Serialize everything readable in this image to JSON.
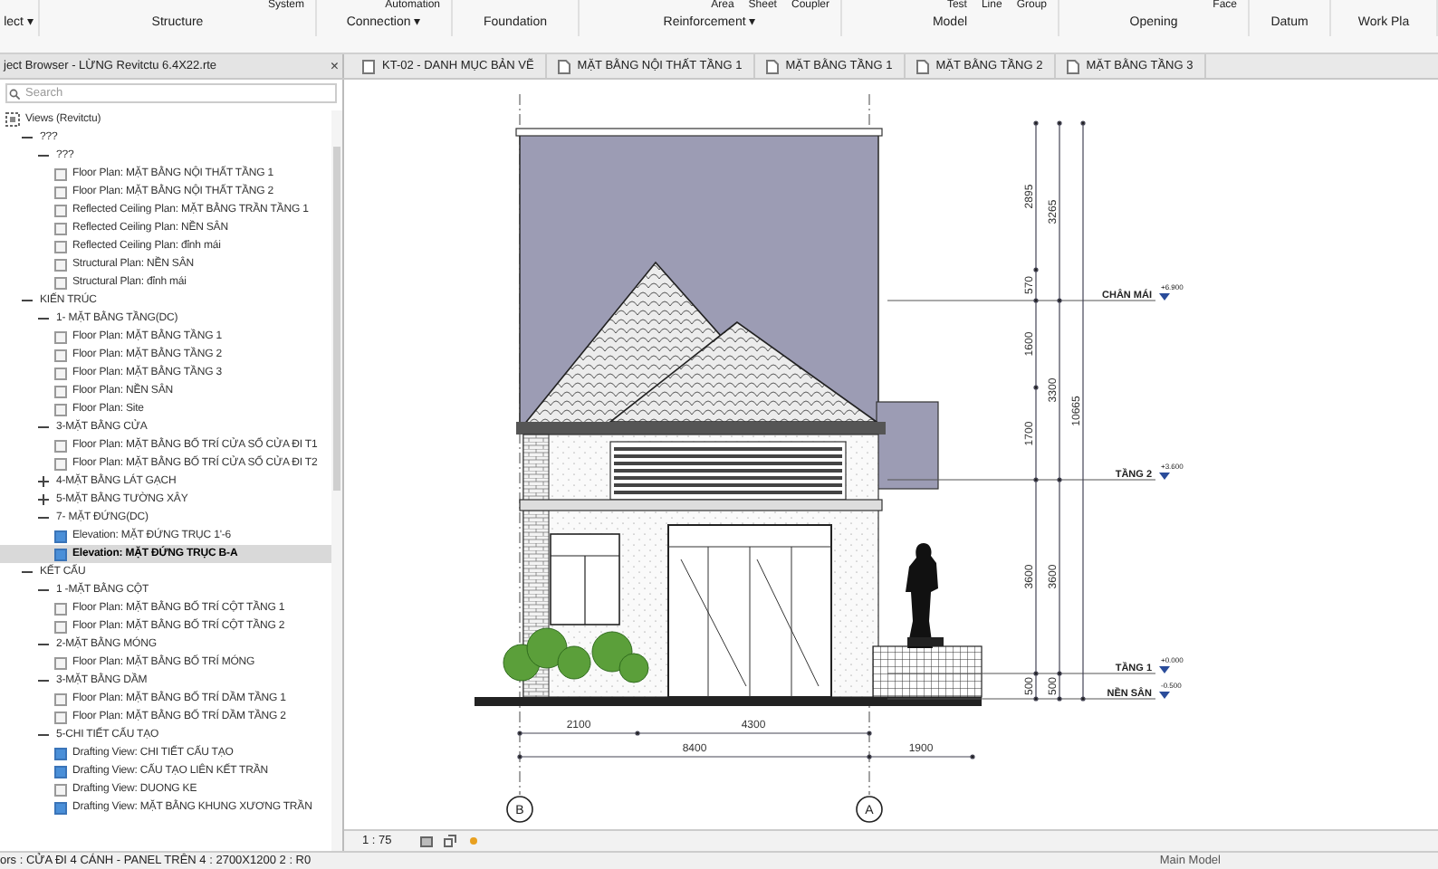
{
  "ribbon": {
    "panels": [
      {
        "label": "lect ▾"
      },
      {
        "label": "Structure",
        "items": [
          "System"
        ]
      },
      {
        "label": "Connection ▾",
        "items": [
          "Automation"
        ]
      },
      {
        "label": "Foundation"
      },
      {
        "label": "Reinforcement ▾",
        "items": [
          "Area",
          "Sheet",
          "Coupler"
        ]
      },
      {
        "label": "Model",
        "items": [
          "Test",
          "Line",
          "Group"
        ]
      },
      {
        "label": "Opening",
        "items": [
          "Face"
        ]
      },
      {
        "label": "Datum"
      },
      {
        "label": "Work Pla"
      }
    ]
  },
  "project_browser": {
    "title": "ject Browser - LỪNG Revitctu 6.4X22.rte",
    "close": "×",
    "search": {
      "placeholder": "Search"
    },
    "tree": [
      {
        "label": "Views (Revitctu)",
        "kind": "root",
        "children": [
          {
            "label": "???",
            "kind": "group",
            "expanded": true,
            "children": [
              {
                "label": "???",
                "kind": "group",
                "expanded": true,
                "children": [
                  {
                    "label": "Floor Plan: MẶT BẰNG NỘI THẤT TẦNG 1",
                    "kind": "view",
                    "on_sheet": false,
                    "selected": false
                  },
                  {
                    "label": "Floor Plan: MẶT BẰNG NỘI THẤT TẦNG 2",
                    "kind": "view",
                    "on_sheet": false,
                    "selected": false
                  },
                  {
                    "label": "Reflected Ceiling Plan: MẶT BẰNG TRẦN TẦNG 1",
                    "kind": "view",
                    "on_sheet": false,
                    "selected": false
                  },
                  {
                    "label": "Reflected Ceiling Plan: NỀN SÂN",
                    "kind": "view",
                    "on_sheet": false,
                    "selected": false
                  },
                  {
                    "label": "Reflected Ceiling Plan: đỉnh mái",
                    "kind": "view",
                    "on_sheet": false,
                    "selected": false
                  },
                  {
                    "label": "Structural Plan: NỀN SÂN",
                    "kind": "view",
                    "on_sheet": false,
                    "selected": false
                  },
                  {
                    "label": "Structural Plan: đỉnh mái",
                    "kind": "view",
                    "on_sheet": false,
                    "selected": false
                  }
                ]
              }
            ]
          },
          {
            "label": "KIẾN TRÚC",
            "kind": "group",
            "expanded": true,
            "children": [
              {
                "label": "1- MẶT BẰNG TẦNG(DC)",
                "kind": "group",
                "expanded": true,
                "children": [
                  {
                    "label": "Floor Plan: MẶT BẰNG TẦNG 1",
                    "kind": "view",
                    "on_sheet": false,
                    "selected": false
                  },
                  {
                    "label": "Floor Plan: MẶT BẰNG TẦNG 2",
                    "kind": "view",
                    "on_sheet": false,
                    "selected": false
                  },
                  {
                    "label": "Floor Plan: MẶT BẰNG TẦNG 3",
                    "kind": "view",
                    "on_sheet": false,
                    "selected": false
                  },
                  {
                    "label": "Floor Plan: NỀN SÂN",
                    "kind": "view",
                    "on_sheet": false,
                    "selected": false
                  },
                  {
                    "label": "Floor Plan: Site",
                    "kind": "view",
                    "on_sheet": false,
                    "selected": false
                  }
                ]
              },
              {
                "label": "3-MẶT BẰNG CỬA",
                "kind": "group",
                "expanded": true,
                "children": [
                  {
                    "label": "Floor Plan: MẶT BẰNG BỐ TRÍ CỬA SỔ CỬA ĐI T1",
                    "kind": "view",
                    "on_sheet": false,
                    "selected": false
                  },
                  {
                    "label": "Floor Plan: MẶT BẰNG BỐ TRÍ CỬA SỔ CỬA ĐI T2",
                    "kind": "view",
                    "on_sheet": false,
                    "selected": false
                  }
                ]
              },
              {
                "label": "4-MẶT BẰNG LÁT GẠCH",
                "kind": "group",
                "expanded": false
              },
              {
                "label": "5-MẶT BẰNG TƯỜNG XÂY",
                "kind": "group",
                "expanded": false
              },
              {
                "label": "7- MẶT ĐỨNG(DC)",
                "kind": "group",
                "expanded": true,
                "children": [
                  {
                    "label": "Elevation: MẶT ĐỨNG TRỤC 1'-6",
                    "kind": "view",
                    "on_sheet": true,
                    "selected": false
                  },
                  {
                    "label": "Elevation: MẶT ĐỨNG TRỤC B-A",
                    "kind": "view",
                    "on_sheet": true,
                    "selected": true
                  }
                ]
              }
            ]
          },
          {
            "label": "KẾT CẤU",
            "kind": "group",
            "expanded": true,
            "children": [
              {
                "label": "1 -MẶT BẰNG CỘT",
                "kind": "group",
                "expanded": true,
                "children": [
                  {
                    "label": "Floor Plan: MẶT BẰNG BỐ TRÍ CỘT TẦNG 1",
                    "kind": "view",
                    "on_sheet": false,
                    "selected": false
                  },
                  {
                    "label": "Floor Plan: MẶT BẰNG BỐ TRÍ CỘT TẦNG 2",
                    "kind": "view",
                    "on_sheet": false,
                    "selected": false
                  }
                ]
              },
              {
                "label": "2-MẶT BẰNG MÓNG",
                "kind": "group",
                "expanded": true,
                "children": [
                  {
                    "label": "Floor Plan: MẶT BẰNG BỐ TRÍ MÓNG",
                    "kind": "view",
                    "on_sheet": false,
                    "selected": false
                  }
                ]
              },
              {
                "label": "3-MẶT BẰNG DẦM",
                "kind": "group",
                "expanded": true,
                "children": [
                  {
                    "label": "Floor Plan: MẶT BẰNG BỐ TRÍ DẦM TẦNG 1",
                    "kind": "view",
                    "on_sheet": false,
                    "selected": false
                  },
                  {
                    "label": "Floor Plan: MẶT BẰNG BỐ TRÍ DẦM TẦNG 2",
                    "kind": "view",
                    "on_sheet": false,
                    "selected": false
                  }
                ]
              },
              {
                "label": "5-CHI TIẾT CẤU TẠO",
                "kind": "group",
                "expanded": true,
                "children": [
                  {
                    "label": "Drafting View: CHI TIẾT CẤU TẠO",
                    "kind": "view",
                    "on_sheet": true,
                    "selected": false
                  },
                  {
                    "label": "Drafting View: CẤU TẠO LIÊN KẾT TRẦN",
                    "kind": "view",
                    "on_sheet": true,
                    "selected": false
                  },
                  {
                    "label": "Drafting View: DUONG KE",
                    "kind": "view",
                    "on_sheet": false,
                    "selected": false
                  },
                  {
                    "label": "Drafting View: MẶT BẰNG KHUNG XƯƠNG TRẦN",
                    "kind": "view",
                    "on_sheet": true,
                    "selected": false
                  }
                ]
              }
            ]
          }
        ]
      }
    ]
  },
  "document_tabs": [
    {
      "label": "KT-02 - DANH MỤC BẢN VẼ",
      "kind": "sheet",
      "selected": false
    },
    {
      "label": "MẶT BẰNG NỘI THẤT TẦNG 1",
      "kind": "plan",
      "selected": false
    },
    {
      "label": "MẶT BẰNG TẦNG 1",
      "kind": "plan",
      "selected": false
    },
    {
      "label": "MẶT BẰNG TẦNG 2",
      "kind": "plan",
      "selected": false
    },
    {
      "label": "MẶT BẰNG TẦNG 3",
      "kind": "plan",
      "selected": false
    }
  ],
  "drawing": {
    "vertical_dimensions": [
      [
        "2895",
        "570",
        "1600",
        "1700",
        "3600",
        "500"
      ],
      [
        "3265",
        "3300",
        "3600",
        "500"
      ],
      [
        "10665"
      ]
    ],
    "levels": [
      {
        "name": "CHÂN MÁI",
        "elevation": "+6.900"
      },
      {
        "name": "TẦNG 2",
        "elevation": "+3.600"
      },
      {
        "name": "TẦNG 1",
        "elevation": "+0.000"
      },
      {
        "name": "NỀN SÂN",
        "elevation": "-0.500"
      }
    ],
    "horizontal_dimensions": [
      [
        "2100",
        "4300"
      ],
      [
        "8400",
        "1900"
      ]
    ],
    "grids": [
      "B",
      "A"
    ]
  },
  "view_bar": {
    "scale": "1 : 75"
  },
  "status_bar": {
    "text": "ors : CỬA ĐI 4 CÁNH - PANEL TRÊN 4 : 2700X1200 2 : R0",
    "workset": "Main Model"
  }
}
